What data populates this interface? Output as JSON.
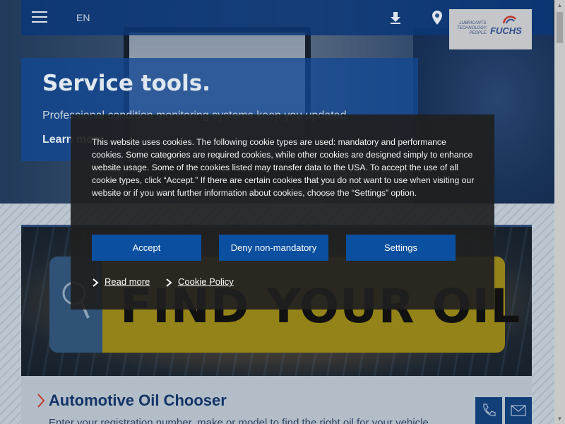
{
  "header": {
    "language": "EN",
    "logo": {
      "tagline": "LUBRICANTS. TECHNOLOGY. PEOPLE.",
      "brand": "FUCHS"
    }
  },
  "hero": {
    "title": "Service tools.",
    "subtitle": "Professional condition monitoring systems keep you updated.",
    "link": "Learn more"
  },
  "oil_banner": {
    "text": "FIND YOUR OIL"
  },
  "automotive": {
    "title": "Automotive Oil Chooser",
    "description": "Enter your registration number, make or model to find the right oil for your vehicle."
  },
  "cookie_dialog": {
    "text": "This website uses cookies. The following cookie types are used: mandatory and performance cookies. Some categories are required cookies, while other cookies are designed simply to enhance website usage. Some of the cookies listed may transfer data to the USA. To accept the use of all cookie types, click “Accept.” If there are certain cookies that you do not want to use when visiting our website or if you want further information about cookies, choose the “Settings” option.",
    "accept_label": "Accept",
    "deny_label": "Deny non-mandatory",
    "settings_label": "Settings",
    "read_more_label": "Read more",
    "cookie_policy_label": "Cookie Policy"
  },
  "colors": {
    "brand_blue": "#0a4fa0",
    "dialog_bg": "#202020",
    "accent_red": "#c0392b"
  },
  "icons": [
    "menu-icon",
    "download-icon",
    "location-pin-icon",
    "search-icon",
    "chevron-right-icon",
    "phone-icon",
    "mail-icon"
  ]
}
